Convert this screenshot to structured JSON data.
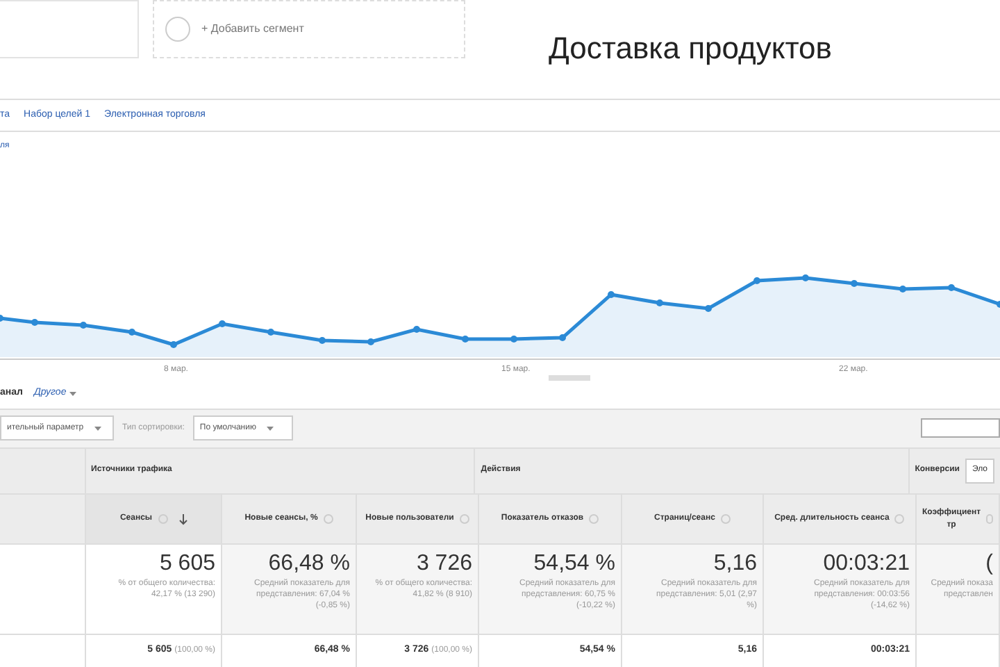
{
  "segments": {
    "add_label": "+ Добавить сегмент"
  },
  "title": "Доставка продуктов",
  "tabs": [
    {
      "label": "та",
      "selected": false
    },
    {
      "label": "Набор целей 1",
      "selected": false
    },
    {
      "label": "Электронная торговля",
      "selected": false
    }
  ],
  "chart": {
    "legend": "ля",
    "x_labels": [
      "8 мар.",
      "15 мар.",
      "22 мар."
    ]
  },
  "dimension": {
    "current": "анал",
    "other": "Другое"
  },
  "toolbar": {
    "secondary": "ительный параметр",
    "sort_label": "Тип сортировки:",
    "sort_value": "По умолчанию",
    "conversions_select": "Эло"
  },
  "table": {
    "groups": [
      "Источники трафика",
      "Действия",
      "Конверсии"
    ],
    "columns": [
      {
        "header": "Сеансы",
        "sorted": true,
        "total": "5 605",
        "note": "% от общего количества: 42,17 % (13 290)",
        "row": "5 605",
        "row_note": "(100,00 %)"
      },
      {
        "header": "Новые сеансы, %",
        "sorted": false,
        "total": "66,48 %",
        "note": "Средний показатель для представления: 67,04 % (-0,85 %)",
        "row": "66,48 %"
      },
      {
        "header": "Новые пользователи",
        "sorted": false,
        "total": "3 726",
        "note": "% от общего количества: 41,82 % (8 910)",
        "row": "3 726",
        "row_note": "(100,00 %)"
      },
      {
        "header": "Показатель отказов",
        "sorted": false,
        "total": "54,54 %",
        "note": "Средний показатель для представления: 60,75 % (-10,22 %)",
        "row": "54,54 %"
      },
      {
        "header": "Страниц/сеанс",
        "sorted": false,
        "total": "5,16",
        "note": "Средний показатель для представления: 5,01 (2,97 %)",
        "row": "5,16"
      },
      {
        "header": "Сред. длительность сеанса",
        "sorted": false,
        "total": "00:03:21",
        "note": "Средний показатель для представления: 00:03:56 (-14,62 %)",
        "row": "00:03:21"
      },
      {
        "header": "Коэффициент тр",
        "sorted": false,
        "total": "(",
        "note": "Средний показа представлен"
      }
    ]
  }
}
